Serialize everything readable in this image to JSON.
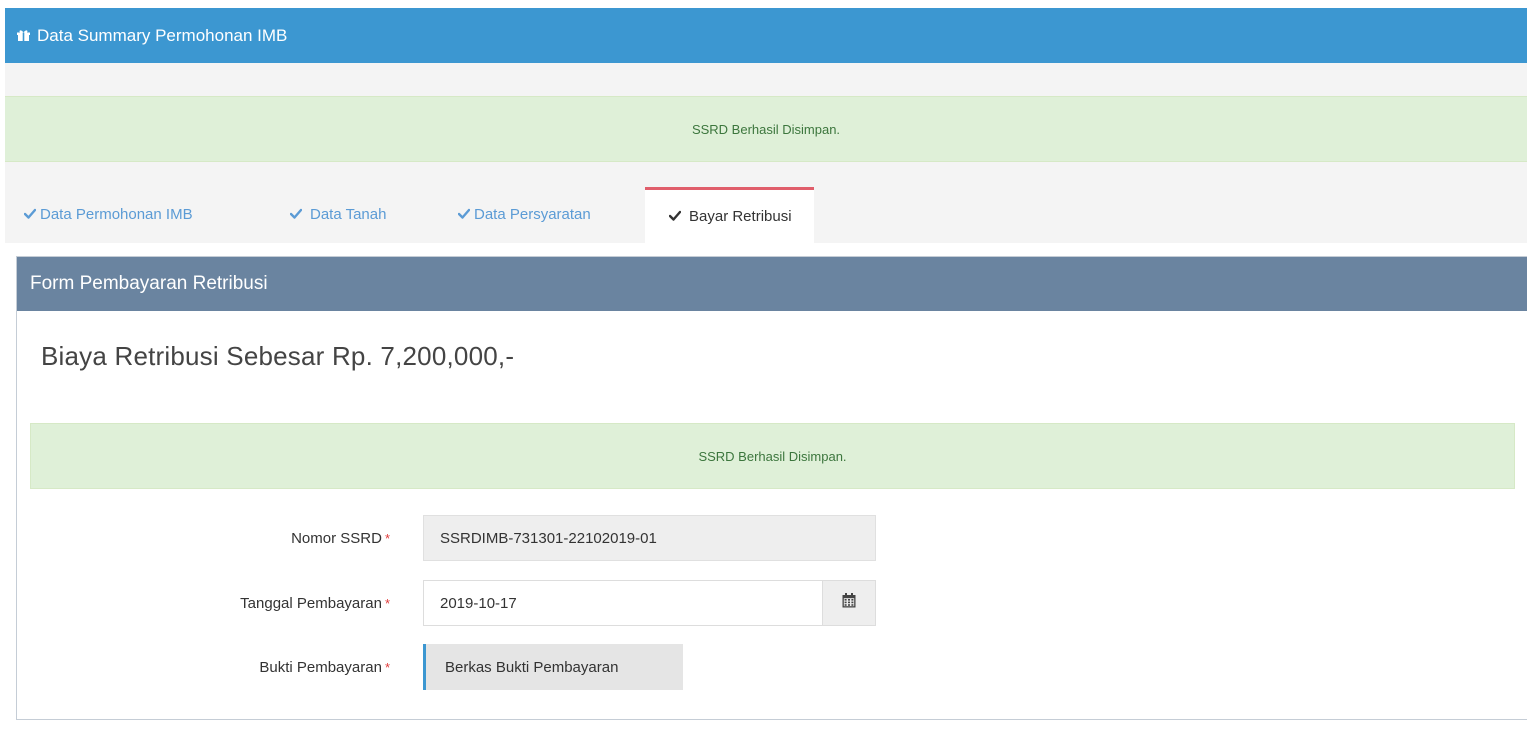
{
  "header": {
    "icon": "gift-icon",
    "title": "Data Summary Permohonan IMB",
    "color": "#3c97d1"
  },
  "alerts": {
    "top_message": "SSRD Berhasil Disimpan.",
    "inner_message": "SSRD Berhasil Disimpan."
  },
  "tabs": [
    {
      "label": "Data Permohonan IMB",
      "icon": "check-icon",
      "active": false
    },
    {
      "label": "Data Tanah",
      "icon": "check-icon",
      "active": false
    },
    {
      "label": "Data Persyaratan",
      "icon": "check-icon",
      "active": false
    },
    {
      "label": "Bayar Retribusi",
      "icon": "check-icon",
      "active": true
    }
  ],
  "panel": {
    "title": "Form Pembayaran Retribusi",
    "amount_text": "Biaya Retribusi Sebesar Rp. 7,200,000,-"
  },
  "form": {
    "required_mark": "*",
    "nomor_ssrd": {
      "label": "Nomor SSRD",
      "value": "SSRDIMB-731301-22102019-01"
    },
    "tanggal_pembayaran": {
      "label": "Tanggal Pembayaran",
      "value": "2019-10-17",
      "icon": "calendar-icon"
    },
    "bukti_pembayaran": {
      "label": "Bukti Pembayaran",
      "button_label": "Berkas Bukti Pembayaran"
    }
  },
  "colors": {
    "accent_blue": "#3c97d1",
    "panel_heading": "#6a84a0",
    "success_bg": "#dff0d8",
    "success_text": "#3c763d",
    "active_tab_border": "#e05e6b",
    "required_red": "#e03a3a"
  }
}
